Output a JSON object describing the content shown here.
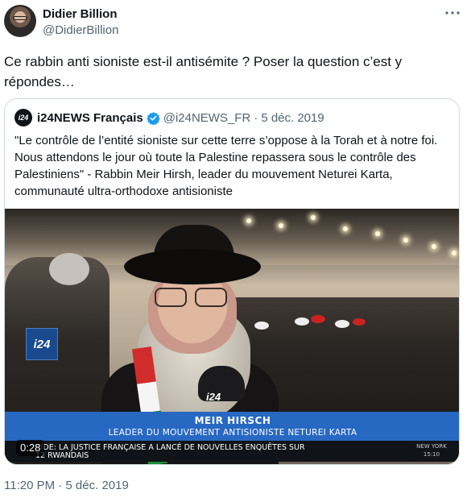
{
  "author": {
    "name": "Didier Billion",
    "handle": "@DidierBillion"
  },
  "tweet": {
    "text": "Ce rabbin anti sioniste est-il antisémite ? Poser la question c’est y\nrépondes…",
    "timestamp": "11:20 PM · 5 déc. 2019"
  },
  "quote": {
    "logo_text": "i24",
    "name": "i24NEWS Français",
    "handle": "@i24NEWS_FR",
    "separator": "·",
    "date": "5 déc. 2019",
    "text": "\"Le contrôle de l’entité sioniste sur cette terre s’oppose à la Torah et à notre foi. Nous attendons le jour où toute la Palestine repassera sous le contrôle des Palestiniens\" - Rabbin Meir Hirsh, leader du mouvement Neturei Karta, communauté ultra-orthodoxe antisioniste"
  },
  "video": {
    "channel_logo": "i24",
    "mic_label": "i24",
    "duration": "0:28",
    "lower_third_name": "MEIR HIRSCH",
    "lower_third_sub": "LEADER DU MOUVEMENT ANTISIONISTE NETUREI KARTA",
    "ticker": "CIDE: LA JUSTICE FRANÇAISE A LANCÉ DE NOUVELLES ENQUÊTES SUR\n12 RWANDAIS",
    "clock": "NEW YORK\n15:10"
  },
  "colors": {
    "verified": "#1d9bf0",
    "secondary_text": "#536471",
    "lower_third": "#2768c2"
  },
  "icons": {
    "more": "more-horizontal-icon",
    "verified": "verified-badge-icon"
  }
}
